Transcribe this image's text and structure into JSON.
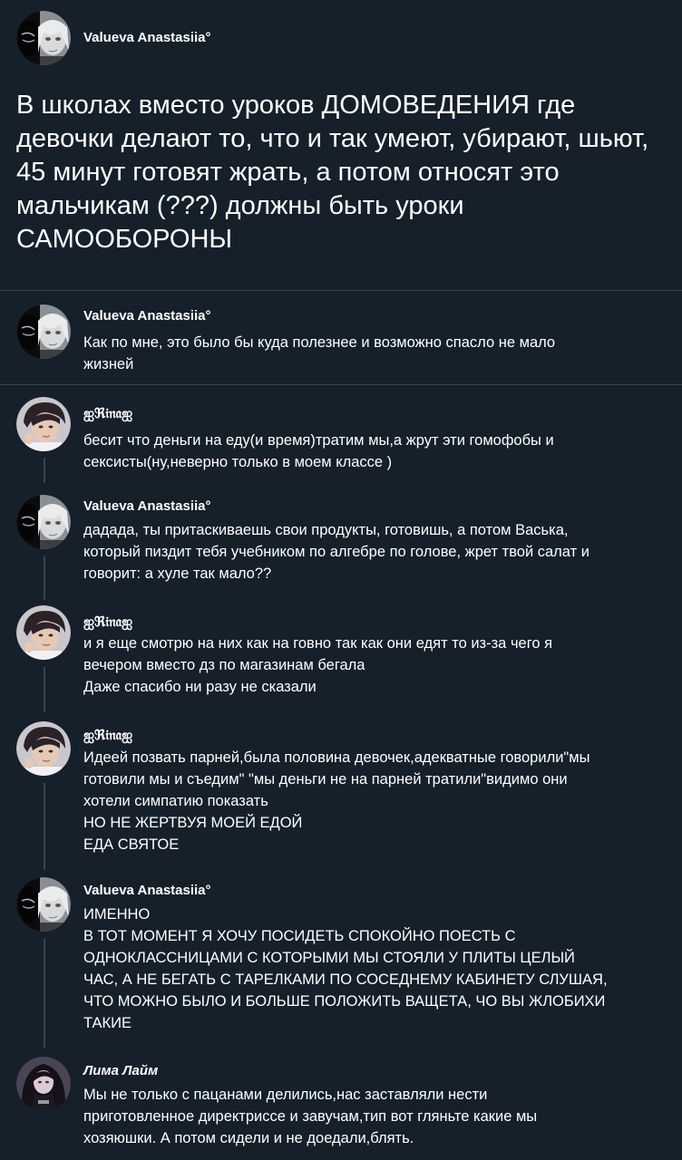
{
  "original_post": {
    "author": "Valueva Anastasiia°",
    "text": "В школах вместо уроков ДОМОВЕДЕНИЯ где\nдевочки делают то, что и так умеют, убирают, шьют,\n45 минут готовят жрать, а потом относят это\nмальчикам (???) должны быть уроки\nСАМООБОРОНЫ"
  },
  "replies": [
    {
      "author": "Valueva Anastasiia°",
      "avatar": "anime-girl-avatar",
      "text": "Как по мне, это было бы куда полезнее и возможно спасло не мало\nжизней"
    },
    {
      "author": "ஐℜ𝔦𝔫𝔞ஐ",
      "avatar": "boy-photo-avatar",
      "text": "бесит что деньги на еду(и время)тратим мы,а жрут эти гомофобы и\nсекcисты(ну,неверно только в моем классе )"
    },
    {
      "author": "Valueva Anastasiia°",
      "avatar": "anime-girl-avatar",
      "text": "дадада, ты притаскиваешь свои продукты, готовишь, а потом Васька,\nкоторый пиздит тебя учебником по алгебре по голове, жрет твой салат и\nговорит: а хуле так мало??"
    },
    {
      "author": "ஐℜ𝔦𝔫𝔞ஐ",
      "avatar": "boy-photo-avatar",
      "text": "и я еще смотрю на них как на говно так как они едят то из-за чего я\nвечером вместо дз по магазинам бегала\nДаже спасибо ни разу не сказали"
    },
    {
      "author": "ஐℜ𝔦𝔫𝔞ஐ",
      "avatar": "boy-photo-avatar",
      "text": "Идеей позвать парней,была половина девочек,адекватные говорили\"мы\nготовили мы и съедим\" \"мы деньги не на парней тратили\"видимо они\nхотели симпатию показать\nНО НЕ ЖЕРТВУЯ МОЕЙ ЕДОЙ\nЕДА СВЯТОЕ"
    },
    {
      "author": "Valueva Anastasiia°",
      "avatar": "anime-girl-avatar",
      "text": "ИМЕННО\nВ ТОТ МОМЕНТ Я ХОЧУ ПОСИДЕТЬ СПОКОЙНО ПОЕСТЬ С\nОДНОКЛАССНИЦАМИ С КОТОРЫМИ МЫ СТОЯЛИ У ПЛИТЫ ЦЕЛЫЙ\nЧАС, А НЕ БЕГАТЬ С ТАРЕЛКАМИ ПО СОСЕДНЕМУ КАБИНЕТУ СЛУШАЯ,\nЧТО МОЖНО БЫЛО И БОЛЬШЕ ПОЛОЖИТЬ ВАЩЕТА, ЧО ВЫ ЖЛОБИХИ\nТАКИЕ"
    },
    {
      "author": "Лима Лайм",
      "avatar": "dark-hair-girl-avatar",
      "text": "Мы не только с пацанами делились,нас заставляли нести\nприготовленное директриссе и завучам,тип вот гляньте какие мы\nхозяюшки. А потом сидели и не доедали,блять."
    }
  ],
  "colors": {
    "background": "#15202b",
    "text": "#ffffff",
    "divider": "#38444d"
  }
}
